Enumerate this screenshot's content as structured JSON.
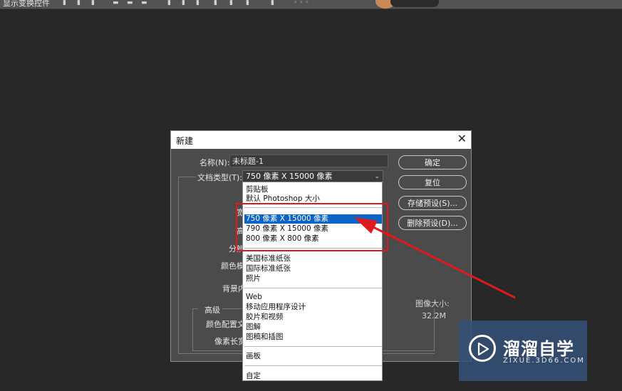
{
  "option_bar": {
    "label": "显示变换控件",
    "icons": [
      "align-top-icon",
      "align-vcenter-icon",
      "align-bottom-icon",
      "align-left-icon",
      "align-hcenter-icon",
      "align-right-icon",
      "distribute-top-icon",
      "distribute-vcenter-icon",
      "distribute-bottom-icon",
      "distribute-left-icon",
      "distribute-hcenter-icon",
      "distribute-right-icon",
      "auto-align-icon",
      "3d-mode-icon"
    ]
  },
  "dialog": {
    "title": "新建",
    "close_glyph": "✕",
    "name_label": "名称(N):",
    "name_value": "未标题-1",
    "doctype_label": "文档类型(T):",
    "doctype_value": "750 像素 X 15000 像素",
    "partial_labels": [
      "宽",
      "高",
      "分辨",
      "颜色模",
      "背景内"
    ],
    "advanced_label": "高级",
    "advanced_labels": [
      "颜色配置文",
      "像素长宽"
    ],
    "buttons": {
      "ok": "确定",
      "reset": "复位",
      "save_preset": "存储预设(S)...",
      "delete_preset": "删除预设(D)..."
    },
    "image_size_label": "图像大小:",
    "image_size_value": "32.2M"
  },
  "dropdown": {
    "items": [
      "剪贴板",
      "默认 Photoshop 大小",
      "750 像素 X 15000 像素",
      "790 像素 X 15000 像素",
      "800 像素 X 800 像素",
      "美国标准纸张",
      "国际标准纸张",
      "照片",
      "Web",
      "移动应用程序设计",
      "胶片和视频",
      "图解",
      "图稿和插图",
      "画板",
      "自定"
    ],
    "selected_index": 2
  },
  "watermark": {
    "name": "溜溜自学",
    "url": "ZIXUE.3D66.COM"
  },
  "colors": {
    "accent": "#e0191c",
    "selection": "#0a64c8"
  }
}
